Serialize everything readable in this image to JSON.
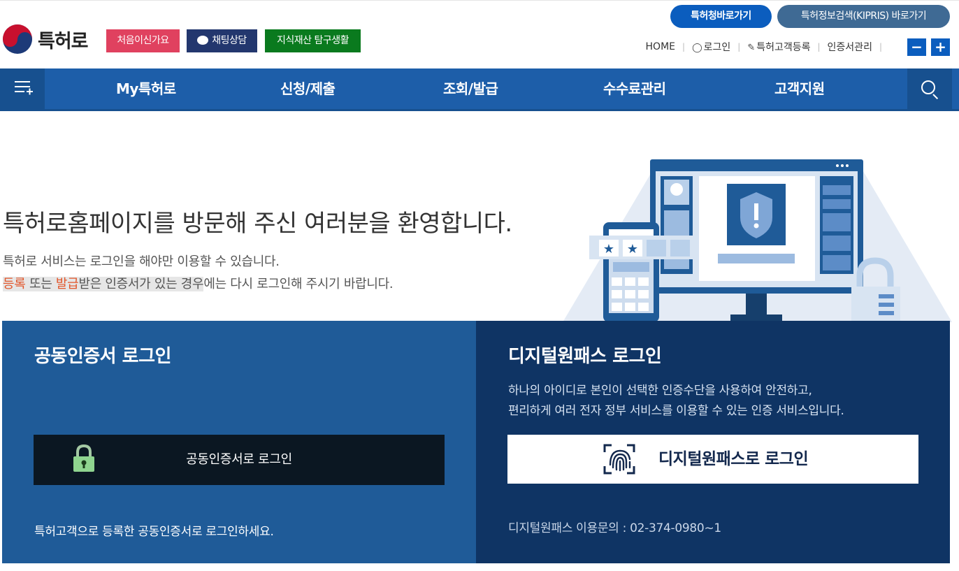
{
  "brand": {
    "name": "특허로"
  },
  "header": {
    "chips": {
      "first_visit": "처음이신가요",
      "chat": "채팅상담",
      "ip_life": "지식재산 탐구생활"
    },
    "pills": {
      "kipo": "특허청바로가기",
      "kipris": "특허정보검색(KIPRIS) 바로가기"
    },
    "util": {
      "home": "HOME",
      "login": "로그인",
      "register": "특허고객등록",
      "cert_manage": "인증서관리"
    },
    "zoom": {
      "minus": "−",
      "plus": "+"
    }
  },
  "nav": {
    "items": [
      "My특허로",
      "신청/제출",
      "조회/발급",
      "수수료관리",
      "고객지원"
    ]
  },
  "hero": {
    "title": "특허로홈페이지를 방문해 주신 여러분을 환영합니다.",
    "line1": "특허로 서비스는 로그인을 해야만 이용할 수 있습니다.",
    "line2": {
      "reg": "등록",
      "or": " 또는 ",
      "issue": "발급",
      "hl_rest": "받은 인증서가 있는 경우",
      "tail": "에는 다시 로그인해 주시기 바랍니다."
    }
  },
  "cert_panel": {
    "title": "공동인증서 로그인",
    "button": "공동인증서로 로그인",
    "note": "특허고객으로 등록한 공동인증서로 로그인하세요."
  },
  "dp_panel": {
    "title": "디지털원패스 로그인",
    "desc1": "하나의 아이디로 본인이 선택한 인증수단을 사용하여 안전하고,",
    "desc2": "편리하게 여러 전자 정부 서비스를 이용할 수 있는 인증 서비스입니다.",
    "button": "디지털원패스로 로그인",
    "contact": "디지털원패스 이용문의 : 02-374-0980~1"
  },
  "colors": {
    "nav_bg": "#1d5ea9",
    "cert_panel_bg": "#1f5b98",
    "dp_panel_bg": "#0f3464",
    "accent_orange": "#e2562b",
    "kipo_blue": "#0b5dbe"
  }
}
